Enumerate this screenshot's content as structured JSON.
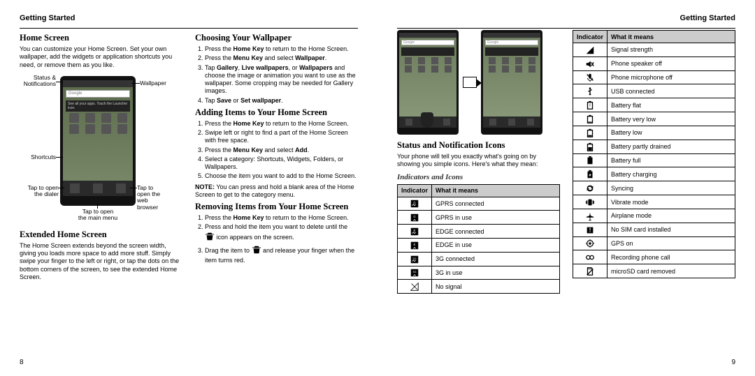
{
  "header": {
    "left_title": "Getting Started",
    "right_title": "Getting Started"
  },
  "page_numbers": {
    "left": "8",
    "right": "9"
  },
  "left_page": {
    "col1": {
      "home_screen": {
        "heading": "Home Screen",
        "body": "You can customize your Home Screen. Set your own wallpaper, add the widgets or application shortcuts you need, or remove them as you like."
      },
      "callouts": {
        "status_notifications": "Status &\nNotifications",
        "wallpaper": "Wallpaper",
        "shortcuts": "Shortcuts",
        "tap_dialer": "Tap to open\nthe dialer",
        "tap_browser": "Tap to open the\nweb browser",
        "tap_menu": "Tap to open\nthe main menu",
        "google_label": "Google",
        "widget_label": "See all your apps.\nTouch the Launcher icon."
      },
      "extended": {
        "heading": "Extended Home Screen",
        "body": "The Home Screen extends beyond the screen width, giving you loads more space to add more stuff. Simply swipe your finger to the left or right, or tap the dots on the bottom corners of the screen, to see the extended Home Screen."
      }
    },
    "col2": {
      "wallpaper": {
        "heading": "Choosing Your Wallpaper",
        "step1_pre": "Press the ",
        "step1_b": "Home Key",
        "step1_post": " to return to the Home Screen.",
        "step2_pre": "Press the ",
        "step2_b": "Menu Key",
        "step2_mid": " and select ",
        "step2_b2": "Wallpaper",
        "step2_post": ".",
        "step3_pre": "Tap ",
        "step3_b1": "Gallery",
        "step3_c1": ", ",
        "step3_b2": "Live wallpapers",
        "step3_c2": ", or ",
        "step3_b3": "Wallpapers",
        "step3_post": " and choose the image or animation you want to use as the wallpaper. Some cropping may be needed for Gallery images.",
        "step4_pre": "Tap ",
        "step4_b1": "Save",
        "step4_mid": " or ",
        "step4_b2": "Set wallpaper",
        "step4_post": "."
      },
      "adding": {
        "heading": "Adding Items to Your Home Screen",
        "step1_pre": "Press the ",
        "step1_b": "Home Key",
        "step1_post": " to return to the Home Screen.",
        "step2": "Swipe left or right to find a part of the Home Screen with free space.",
        "step3_pre": "Press the ",
        "step3_b": "Menu Key",
        "step3_mid": " and select ",
        "step3_b2": "Add",
        "step3_post": ".",
        "step4": "Select a category: Shortcuts, Widgets, Folders, or Wallpapers.",
        "step5": "Choose the item you want to add to the Home Screen.",
        "note_b": "NOTE:",
        "note_post": " You can press and hold a blank area of the Home Screen to get to the category menu."
      },
      "removing": {
        "heading": "Removing Items from Your Home Screen",
        "step1_pre": "Press the ",
        "step1_b": "Home Key",
        "step1_post": " to return to the Home Screen.",
        "step2_pre": "Press and hold the item you want to delete until the ",
        "step2_post": " icon appears on the screen.",
        "step3_pre": "Drag the item to ",
        "step3_post": " and release your finger when the item turns red."
      }
    }
  },
  "right_page": {
    "col1": {
      "google_label": "Google",
      "status_icons": {
        "heading": "Status and Notification Icons",
        "body": "Your phone will tell you exactly what's going on by showing you simple icons. Here's what they mean:"
      },
      "sub_heading": "Indicators and Icons",
      "table1_header": {
        "c1": "Indicator",
        "c2": "What it means"
      },
      "table1": [
        {
          "icon": "gprs-conn-icon",
          "label": "GPRS connected"
        },
        {
          "icon": "gprs-use-icon",
          "label": "GPRS in use"
        },
        {
          "icon": "edge-conn-icon",
          "label": "EDGE connected"
        },
        {
          "icon": "edge-use-icon",
          "label": "EDGE in use"
        },
        {
          "icon": "3g-conn-icon",
          "label": "3G connected"
        },
        {
          "icon": "3g-use-icon",
          "label": "3G in use"
        },
        {
          "icon": "no-signal-icon",
          "label": "No signal"
        }
      ]
    },
    "col2": {
      "table2_header": {
        "c1": "Indicator",
        "c2": "What it means"
      },
      "table2": [
        {
          "icon": "signal-icon",
          "label": "Signal strength"
        },
        {
          "icon": "speaker-off-icon",
          "label": "Phone speaker off"
        },
        {
          "icon": "mic-off-icon",
          "label": "Phone microphone off"
        },
        {
          "icon": "usb-icon",
          "label": "USB connected"
        },
        {
          "icon": "battery-flat-icon",
          "label": "Battery flat"
        },
        {
          "icon": "battery-vlow-icon",
          "label": "Battery very low"
        },
        {
          "icon": "battery-low-icon",
          "label": "Battery low"
        },
        {
          "icon": "battery-partly-icon",
          "label": "Battery partly drained"
        },
        {
          "icon": "battery-full-icon",
          "label": "Battery full"
        },
        {
          "icon": "battery-charging-icon",
          "label": "Battery charging"
        },
        {
          "icon": "syncing-icon",
          "label": "Syncing"
        },
        {
          "icon": "vibrate-icon",
          "label": "Vibrate mode"
        },
        {
          "icon": "airplane-icon",
          "label": "Airplane mode"
        },
        {
          "icon": "no-sim-icon",
          "label": "No SIM card installed"
        },
        {
          "icon": "gps-icon",
          "label": "GPS on"
        },
        {
          "icon": "recording-icon",
          "label": "Recording phone call"
        },
        {
          "icon": "microsd-icon",
          "label": "microSD card removed"
        }
      ]
    }
  }
}
